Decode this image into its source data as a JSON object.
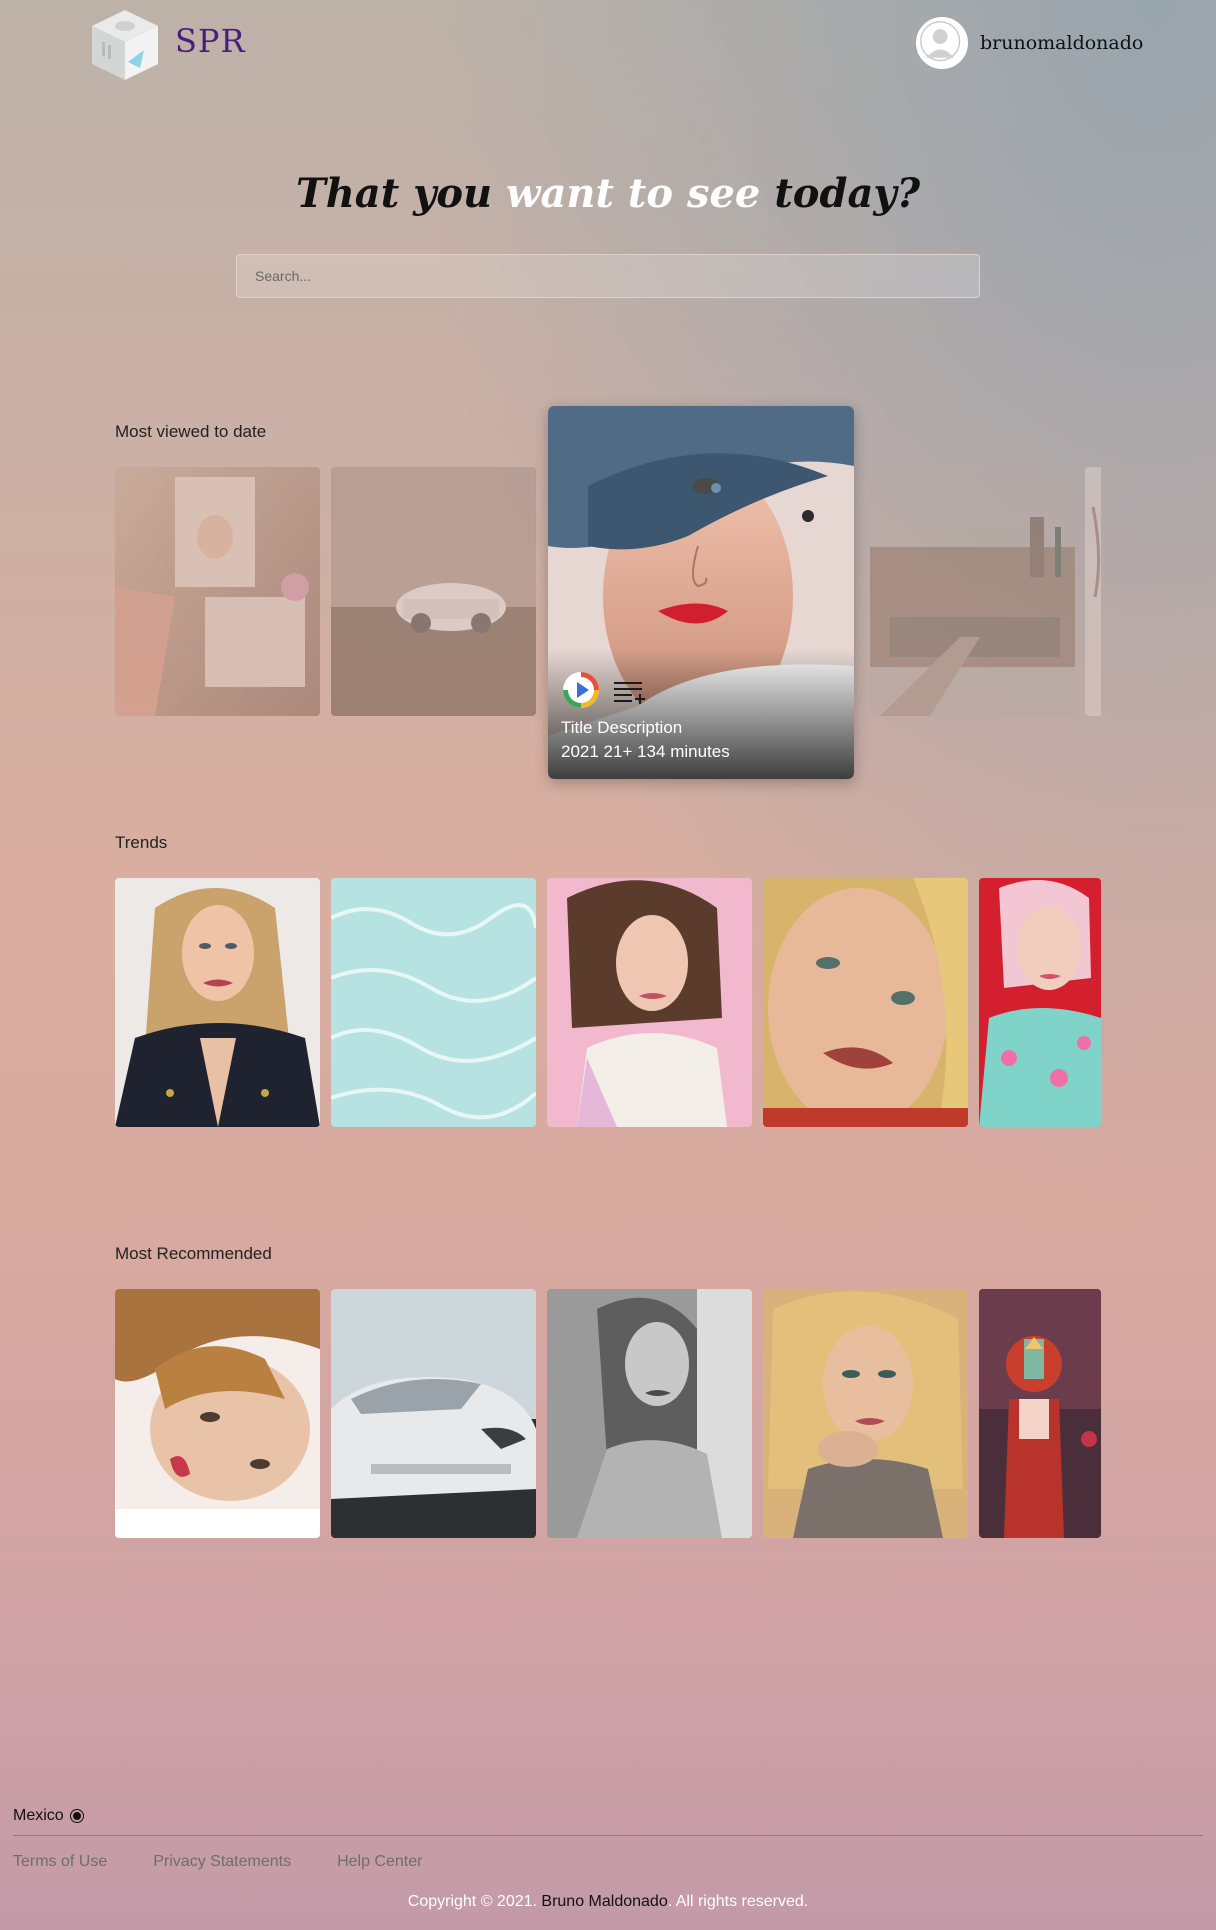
{
  "header": {
    "brand": "SPR",
    "username": "brunomaldonado"
  },
  "hero": {
    "title_part1": "That you ",
    "title_highlight": "want to see",
    "title_part2": " today?",
    "search_placeholder": "Search..."
  },
  "sections": {
    "most_viewed": {
      "title": "Most viewed to date",
      "featured": {
        "title": "Title Description",
        "meta": "2021 21+ 134 minutes"
      }
    },
    "trends": {
      "title": "Trends"
    },
    "recommended": {
      "title": "Most Recommended"
    }
  },
  "footer": {
    "country": "Mexico",
    "links": [
      "Terms of Use",
      "Privacy Statements",
      "Help Center"
    ],
    "copyright_prefix": "Copyright © 2021. ",
    "copyright_owner": "Bruno Maldonado",
    "copyright_suffix": ". All rights reserved."
  },
  "icons": {
    "logo": "cube-logo",
    "avatar": "user-silhouette-icon",
    "play": "play-icon",
    "add_to_list": "playlist-add-icon"
  }
}
